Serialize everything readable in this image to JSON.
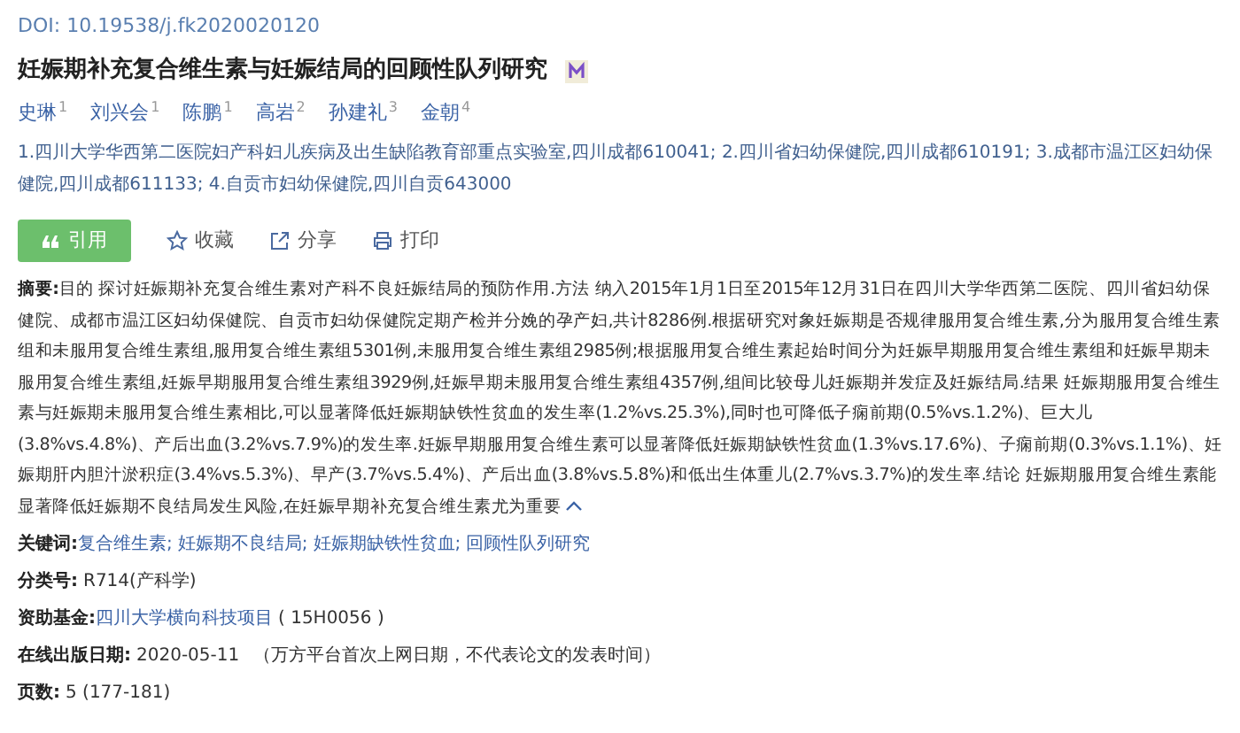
{
  "doi": "DOI: 10.19538/j.fk2020020120",
  "title": "妊娠期补充复合维生素与妊娠结局的回顾性队列研究",
  "authors": [
    {
      "name": "史琳",
      "mark": "1"
    },
    {
      "name": "刘兴会",
      "mark": "1"
    },
    {
      "name": "陈鹏",
      "mark": "1"
    },
    {
      "name": "高岩",
      "mark": "2"
    },
    {
      "name": "孙建礼",
      "mark": "3"
    },
    {
      "name": "金朝",
      "mark": "4"
    }
  ],
  "affiliations": "1.四川大学华西第二医院妇产科妇儿疾病及出生缺陷教育部重点实验室,四川成都610041; 2.四川省妇幼保健院,四川成都610191; 3.成都市温江区妇幼保健院,四川成都611133; 4.自贡市妇幼保健院,四川自贡643000",
  "actions": [
    {
      "kind": "cite",
      "label": "引用"
    },
    {
      "kind": "favorite",
      "label": "收藏"
    },
    {
      "kind": "share",
      "label": "分享"
    },
    {
      "kind": "print",
      "label": "打印"
    }
  ],
  "abstract": {
    "label": "摘要:",
    "text": "目的 探讨妊娠期补充复合维生素对产科不良妊娠结局的预防作用.方法 纳入2015年1月1日至2015年12月31日在四川大学华西第二医院、四川省妇幼保健院、成都市温江区妇幼保健院、自贡市妇幼保健院定期产检并分娩的孕产妇,共计8286例.根据研究对象妊娠期是否规律服用复合维生素,分为服用复合维生素组和未服用复合维生素组,服用复合维生素组5301例,未服用复合维生素组2985例;根据服用复合维生素起始时间分为妊娠早期服用复合维生素组和妊娠早期未服用复合维生素组,妊娠早期服用复合维生素组3929例,妊娠早期未服用复合维生素组4357例,组间比较母儿妊娠期并发症及妊娠结局.结果 妊娠期服用复合维生素与妊娠期未服用复合维生素相比,可以显著降低妊娠期缺铁性贫血的发生率(1.2%vs.25.3%),同时也可降低子痫前期(0.5%vs.1.2%)、巨大儿(3.8%vs.4.8%)、产后出血(3.2%vs.7.9%)的发生率.妊娠早期服用复合维生素可以显著降低妊娠期缺铁性贫血(1.3%vs.17.6%)、子痫前期(0.3%vs.1.1%)、妊娠期肝内胆汁淤积症(3.4%vs.5.3%)、早产(3.7%vs.5.4%)、产后出血(3.8%vs.5.8%)和低出生体重儿(2.7%vs.3.7%)的发生率.结论 妊娠期服用复合维生素能显著降低妊娠期不良结局发生风险,在妊娠早期补充复合维生素尤为重要",
    "expanded": true
  },
  "keywords": {
    "label": "关键词:",
    "separator": ";",
    "items": [
      "复合维生素",
      "妊娠期不良结局",
      "妊娠期缺铁性贫血",
      "回顾性队列研究"
    ]
  },
  "fields": [
    {
      "kind": "plain",
      "label": "分类号:",
      "value": "R714(产科学)"
    },
    {
      "kind": "fund",
      "label": "资助基金:",
      "value": "四川大学横向科技项目",
      "code": "( 15H0056 )"
    },
    {
      "kind": "date",
      "label": "在线出版日期:",
      "value": "2020-05-11",
      "note": "（万方平台首次上网日期，不代表论文的发表时间）"
    },
    {
      "kind": "plain",
      "label": "页数:",
      "value": "5 (177-181)"
    }
  ]
}
